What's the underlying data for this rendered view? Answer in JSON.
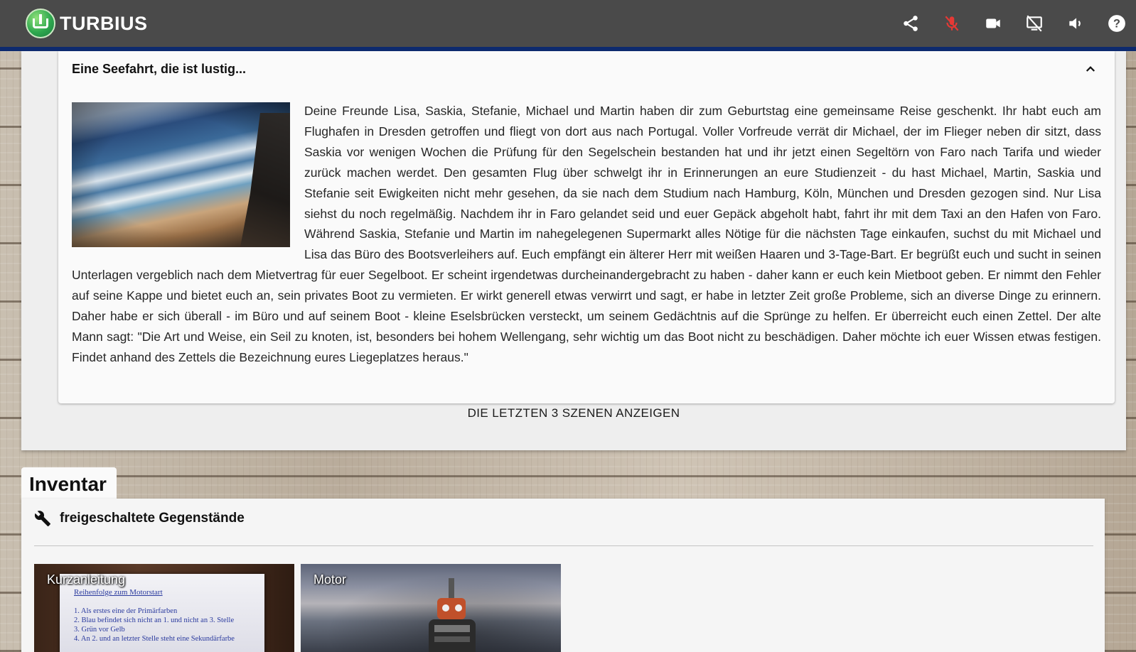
{
  "app": {
    "brand": "TURBIUS"
  },
  "toolbar": {
    "icons": [
      "share-icon",
      "microphone-off-icon",
      "video-camera-icon",
      "screen-share-off-icon",
      "volume-icon",
      "help-icon"
    ],
    "mic_off_color": "#e53935"
  },
  "story": {
    "title": "Eine Seefahrt, die ist lustig...",
    "text": "Deine Freunde Lisa, Saskia, Stefanie, Michael und Martin haben dir zum Geburtstag eine gemeinsame Reise geschenkt. Ihr habt euch am Flughafen in Dresden getroffen und fliegt von dort aus nach Portugal. Voller Vorfreude verrät dir Michael, der im Flieger neben dir sitzt, dass Saskia vor wenigen Wochen die Prüfung für den Segelschein bestanden hat und ihr jetzt einen Segeltörn von Faro nach Tarifa und wieder zurück machen werdet. Den gesamten Flug über schwelgt ihr in Erinnerungen an eure Studienzeit - du hast Michael, Martin, Saskia und Stefanie seit Ewigkeiten nicht mehr gesehen, da sie nach dem Studium nach Hamburg, Köln, München und Dresden gezogen sind. Nur Lisa siehst du noch regelmäßig. Nachdem ihr in Faro gelandet seid und euer Gepäck abgeholt habt, fahrt ihr mit dem Taxi an den Hafen von Faro. Während Saskia, Stefanie und Martin im nahegelegenen Supermarkt alles Nötige für die nächsten Tage einkaufen, suchst du mit Michael und Lisa das Büro des Bootsverleihers auf. Euch empfängt ein älterer Herr mit weißen Haaren und 3-Tage-Bart. Er begrüßt euch und sucht in seinen Unterlagen vergeblich nach dem Mietvertrag für euer Segelboot. Er scheint irgendetwas durcheinandergebracht zu haben - daher kann er euch kein Mietboot geben. Er nimmt den Fehler auf seine Kappe und bietet euch an, sein privates Boot zu vermieten. Er wirkt generell etwas verwirrt und sagt, er habe in letzter Zeit große Probleme, sich an diverse Dinge zu erinnern. Daher habe er sich überall - im Büro und auf seinem Boot - kleine Eselsbrücken versteckt, um seinem Gedächtnis auf die Sprünge zu helfen. Er überreicht euch einen Zettel. Der alte Mann sagt: \"Die Art und Weise, ein Seil zu knoten, ist, besonders bei hohem Wellengang, sehr wichtig um das Boot nicht zu beschädigen. Daher möchte ich euer Wissen etwas festigen. Findet anhand des Zettels die Bezeichnung eures Liegeplatzes heraus.\"",
    "show_scenes_label": "DIE LETZTEN 3 SZENEN ANZEIGEN"
  },
  "inventory": {
    "tab_label": "Inventar",
    "subtitle": "freigeschaltete Gegenstände",
    "items": [
      {
        "label": "Kurzanleitung",
        "paper_title": "Reihenfolge zum Motorstart",
        "paper_lines": [
          "1. Als erstes eine der Primärfarben",
          "2. Blau befindet sich nicht an 1. und nicht an 3. Stelle",
          "3. Grün vor Gelb",
          "4. An 2. und an letzter Stelle steht eine Sekundärfarbe"
        ]
      },
      {
        "label": "Motor"
      }
    ]
  }
}
